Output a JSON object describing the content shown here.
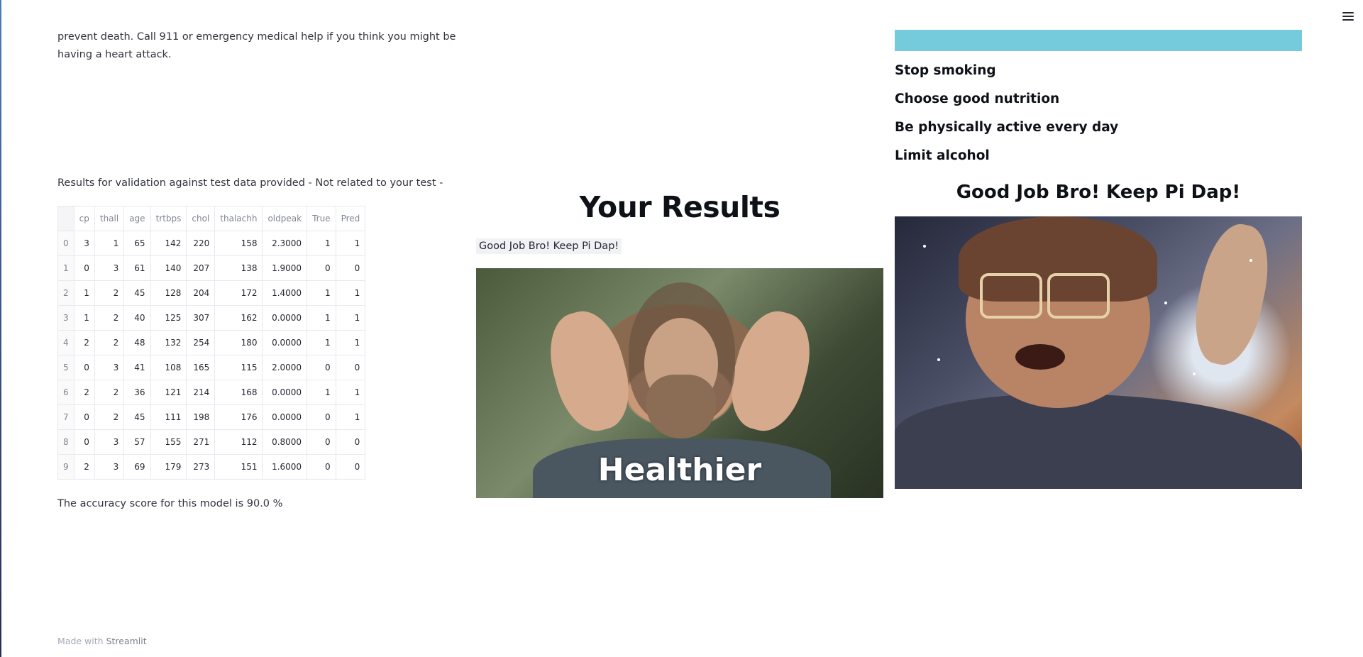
{
  "intro_text": "prevent death. Call 911 or emergency medical help if you think you might be having a heart attack.",
  "validation_caption": "Results for validation against test data provided - Not related to your test -",
  "table": {
    "headers": [
      "",
      "cp",
      "thall",
      "age",
      "trtbps",
      "chol",
      "thalachh",
      "oldpeak",
      "True",
      "Pred"
    ],
    "rows": [
      [
        "0",
        "3",
        "1",
        "65",
        "142",
        "220",
        "158",
        "2.3000",
        "1",
        "1"
      ],
      [
        "1",
        "0",
        "3",
        "61",
        "140",
        "207",
        "138",
        "1.9000",
        "0",
        "0"
      ],
      [
        "2",
        "1",
        "2",
        "45",
        "128",
        "204",
        "172",
        "1.4000",
        "1",
        "1"
      ],
      [
        "3",
        "1",
        "2",
        "40",
        "125",
        "307",
        "162",
        "0.0000",
        "1",
        "1"
      ],
      [
        "4",
        "2",
        "2",
        "48",
        "132",
        "254",
        "180",
        "0.0000",
        "1",
        "1"
      ],
      [
        "5",
        "0",
        "3",
        "41",
        "108",
        "165",
        "115",
        "2.0000",
        "0",
        "0"
      ],
      [
        "6",
        "2",
        "2",
        "36",
        "121",
        "214",
        "168",
        "0.0000",
        "1",
        "1"
      ],
      [
        "7",
        "0",
        "2",
        "45",
        "111",
        "198",
        "176",
        "0.0000",
        "0",
        "1"
      ],
      [
        "8",
        "0",
        "3",
        "57",
        "155",
        "271",
        "112",
        "0.8000",
        "0",
        "0"
      ],
      [
        "9",
        "2",
        "3",
        "69",
        "179",
        "273",
        "151",
        "1.6000",
        "0",
        "0"
      ]
    ]
  },
  "accuracy_text": "The accuracy score for this model is 90.0 %",
  "results": {
    "title": "Your Results",
    "message": "Good Job Bro! Keep Pi Dap!",
    "gif_caption": "Healthier"
  },
  "tips": [
    "Stop smoking",
    "Choose good nutrition",
    "Be physically active every day",
    "Limit alcohol"
  ],
  "right_title": "Good Job Bro! Keep Pi Dap!",
  "footer": {
    "prefix": "Made with",
    "brand": "Streamlit"
  },
  "colors": {
    "info_bar": "#75cbdb",
    "text": "#31333f",
    "heading": "#0e1117"
  },
  "icons": {
    "menu": "hamburger-menu-icon"
  }
}
